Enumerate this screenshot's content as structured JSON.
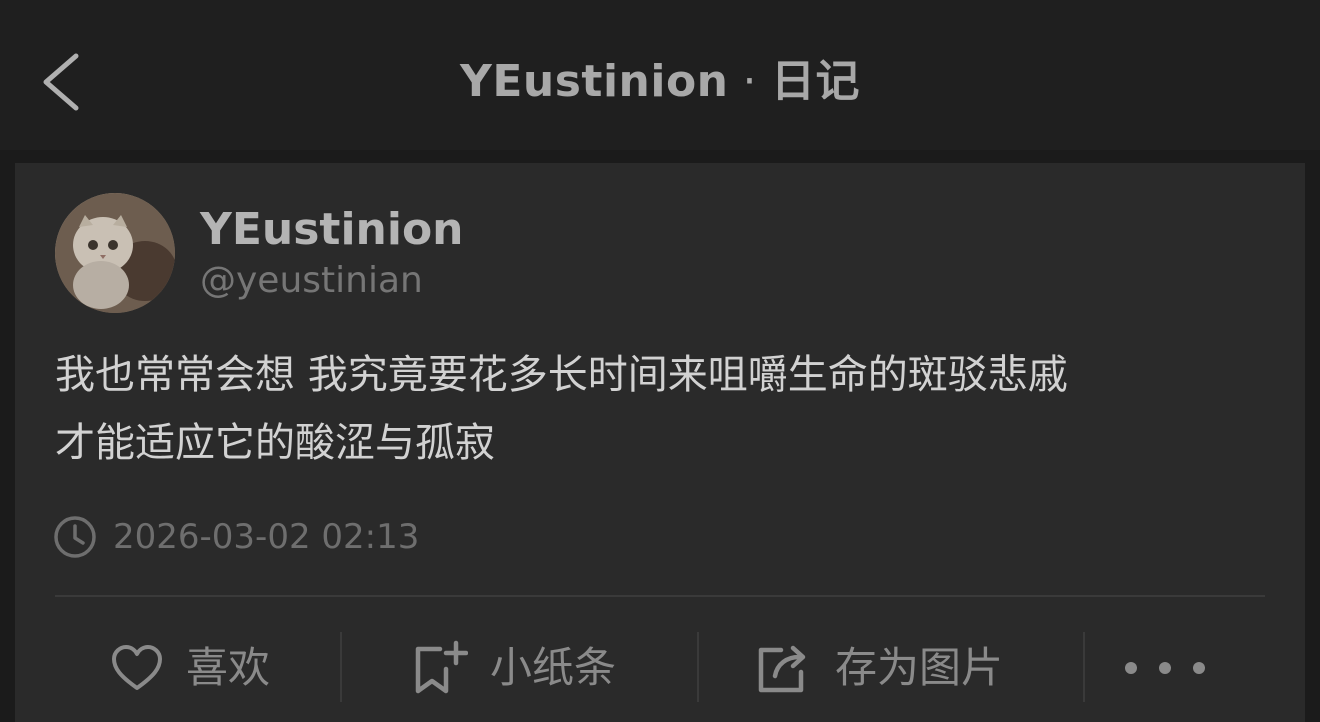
{
  "header": {
    "username": "YEustinion",
    "separator": "·",
    "section": "日记"
  },
  "post": {
    "author_name": "YEustinion",
    "author_handle": "@yeustinian",
    "body_lines": [
      "我也常常会想 我究竟要花多长时间来咀嚼生命的斑驳悲戚",
      "才能适应它的酸涩与孤寂"
    ],
    "timestamp": "2026-03-02 02:13"
  },
  "actions": {
    "like_label": "喜欢",
    "note_label": "小纸条",
    "save_image_label": "存为图片"
  },
  "icons": {
    "back": "chevron-left-icon",
    "clock": "clock-icon",
    "like": "heart-icon",
    "note": "bookmark-plus-icon",
    "share": "share-box-icon",
    "more": "more-dots-icon"
  },
  "colors": {
    "background": "#1b1b1b",
    "header": "#1f1f1f",
    "card": "#2a2a2a",
    "primary_text": "#d2d2d2",
    "secondary_text": "#8a8a8a"
  }
}
